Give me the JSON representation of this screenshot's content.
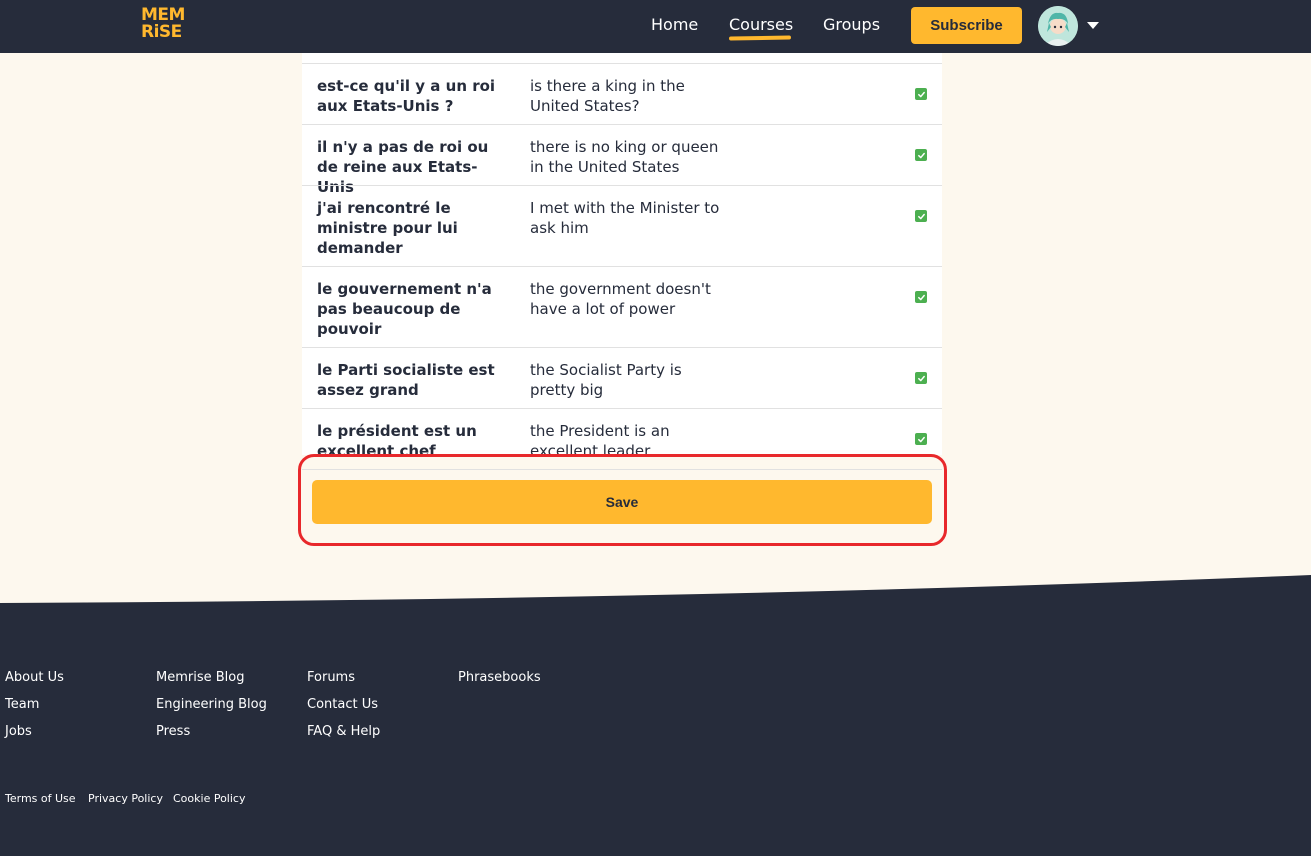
{
  "header": {
    "logo_top": "MEM",
    "logo_bottom": "RiSE",
    "nav": {
      "home": "Home",
      "courses": "Courses",
      "groups": "Groups"
    },
    "subscribe_label": "Subscribe",
    "active_tab": "Courses",
    "accent_color": "#ffb82e"
  },
  "table": {
    "rows": [
      {
        "fr": "est-ce qu'il y a un roi aux Etats-Unis ?",
        "en": "is there a king in the United States?",
        "checked": true
      },
      {
        "fr": "il n'y a pas de roi ou de reine aux Etats-Unis",
        "en": "there is no king or queen in the United States",
        "checked": true
      },
      {
        "fr": "j'ai rencontré le ministre pour lui demander",
        "en": "I met with the Minister to ask him",
        "checked": true
      },
      {
        "fr": "le gouvernement n'a pas beaucoup de pouvoir",
        "en": "the government doesn't have a lot of power",
        "checked": true
      },
      {
        "fr": "le Parti socialiste est assez grand",
        "en": "the Socialist Party is pretty big",
        "checked": true
      },
      {
        "fr": "le président est un excellent chef",
        "en": "the President is an excellent leader",
        "checked": true
      }
    ]
  },
  "save_label": "Save",
  "footer": {
    "col1": [
      "About Us",
      "Team",
      "Jobs"
    ],
    "col2": [
      "Memrise Blog",
      "Engineering Blog",
      "Press"
    ],
    "col3": [
      "Forums",
      "Contact Us",
      "FAQ & Help"
    ],
    "col4": [
      "Phrasebooks"
    ],
    "legal": [
      "Terms of Use",
      "Privacy Policy",
      "Cookie Policy"
    ]
  }
}
